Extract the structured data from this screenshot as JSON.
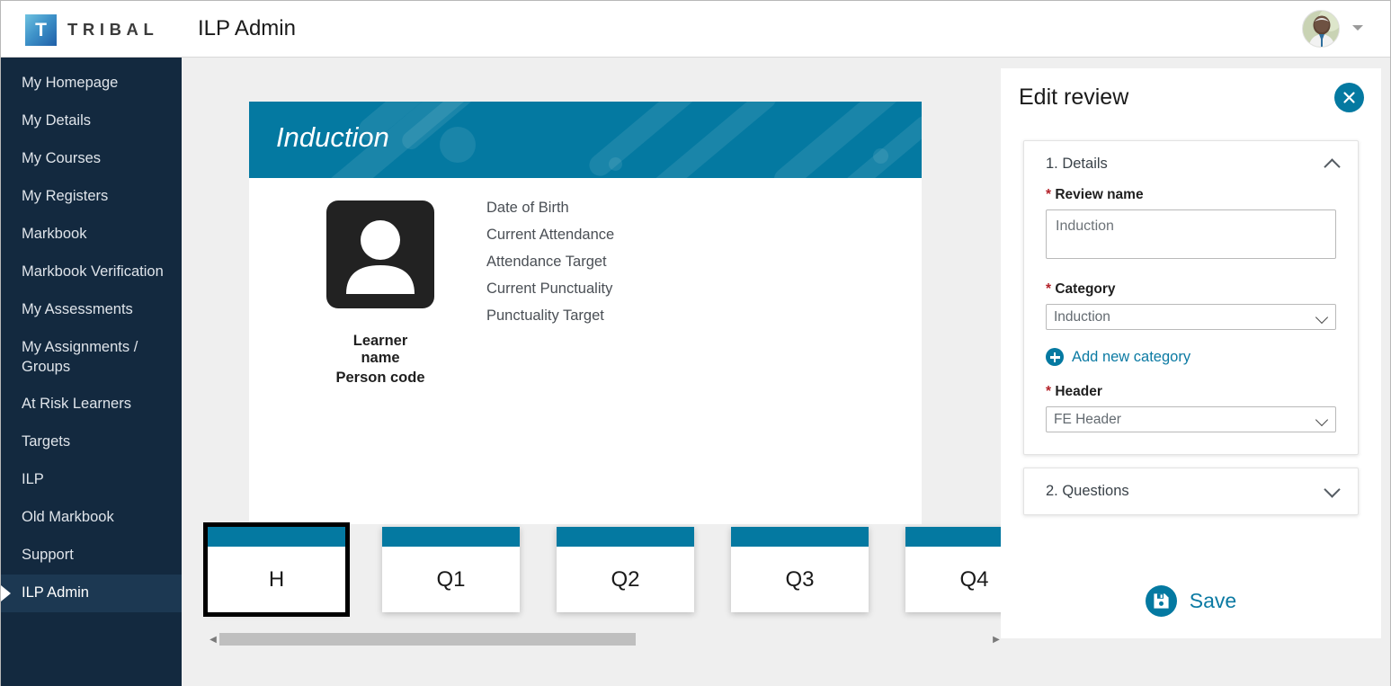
{
  "brand": {
    "logo_letter": "T",
    "logo_word": "TRIBAL",
    "accent_teal": "#0479a1",
    "sidebar_navy": "#13293f",
    "link_teal": "#0b7aa3",
    "required_red": "#b4232a"
  },
  "header": {
    "app_title": "ILP Admin",
    "avatar_icon": "user-photo-avatar",
    "caret_icon": "chevron-down-icon"
  },
  "sidebar": {
    "items": [
      {
        "label": "My Homepage",
        "active": false
      },
      {
        "label": "My Details",
        "active": false
      },
      {
        "label": "My Courses",
        "active": false
      },
      {
        "label": "My Registers",
        "active": false
      },
      {
        "label": "Markbook",
        "active": false
      },
      {
        "label": "Markbook Verification",
        "active": false
      },
      {
        "label": "My Assessments",
        "active": false
      },
      {
        "label": "My Assignments / Groups",
        "active": false
      },
      {
        "label": "At Risk Learners",
        "active": false
      },
      {
        "label": "Targets",
        "active": false
      },
      {
        "label": "ILP",
        "active": false
      },
      {
        "label": "Old Markbook",
        "active": false
      },
      {
        "label": "Support",
        "active": false
      },
      {
        "label": "ILP Admin",
        "active": true
      }
    ]
  },
  "preview": {
    "banner_title": "Induction",
    "avatar_icon": "person-placeholder-icon",
    "learner_name": "Learner name",
    "person_code": "Person code",
    "fields": [
      "Date of Birth",
      "Current Attendance",
      "Attendance Target",
      "Current Punctuality",
      "Punctuality Target"
    ],
    "tabs": [
      {
        "label": "H",
        "selected": true
      },
      {
        "label": "Q1",
        "selected": false
      },
      {
        "label": "Q2",
        "selected": false
      },
      {
        "label": "Q3",
        "selected": false
      },
      {
        "label": "Q4",
        "selected": false
      }
    ],
    "scrollbar": {
      "left_arrow_icon": "triangle-left-icon",
      "right_arrow_icon": "triangle-right-icon",
      "thumb_position_percent": 0,
      "thumb_width_percent": 54
    }
  },
  "panel": {
    "title": "Edit review",
    "close_icon": "close-x-icon",
    "sections": [
      {
        "number_label": "1. Details",
        "expanded": true,
        "chevron_icon": "chevron-up-icon"
      },
      {
        "number_label": "2. Questions",
        "expanded": false,
        "chevron_icon": "chevron-down-icon"
      }
    ],
    "details": {
      "review_name": {
        "label": "Review name",
        "required_marker": "*",
        "value": "Induction",
        "placeholder": "Induction"
      },
      "category": {
        "label": "Category",
        "required_marker": "*",
        "selected": "Induction",
        "options": [
          "Induction"
        ],
        "dropdown_icon": "chevron-down-icon"
      },
      "add_category": {
        "label": "Add new category",
        "icon": "plus-circle-icon"
      },
      "header_select": {
        "label": "Header",
        "required_marker": "*",
        "selected": "FE Header",
        "options": [
          "FE Header"
        ],
        "dropdown_icon": "chevron-down-icon"
      }
    },
    "save": {
      "label": "Save",
      "icon": "save-floppy-icon"
    }
  }
}
